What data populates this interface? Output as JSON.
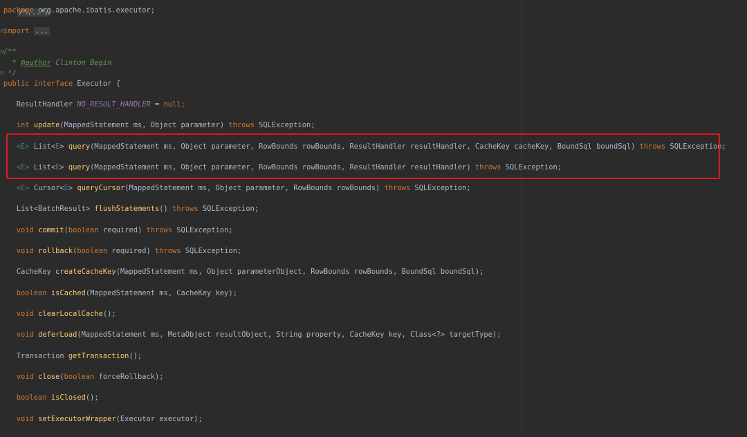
{
  "editor": {
    "lines": {
      "fold_top": "/*...*/",
      "package": {
        "kw": "package",
        "name": "org.apache.ibatis.executor;"
      },
      "import": {
        "kw": "import",
        "fold": "..."
      },
      "javadoc_open": "/**",
      "javadoc_author": {
        "star": "* ",
        "tag": "@author",
        "text": " Clinton Begin"
      },
      "javadoc_close": "*/",
      "interface_decl": {
        "kw1": "public",
        "kw2": "interface",
        "name": "Executor {"
      },
      "no_result_handler": {
        "type": "ResultHandler ",
        "const": "NO_RESULT_HANDLER",
        "rest": " = ",
        "null": "null",
        "end": ";"
      },
      "update": {
        "type": "int ",
        "name": "update",
        "params": "(MappedStatement ms, Object parameter) ",
        "throws": "throws",
        "end": " SQLException;"
      },
      "query1": {
        "g1": "<E>",
        "t": " List<",
        "g2": "E",
        "t2": "> ",
        "name": "query",
        "params": "(MappedStatement ms, Object parameter, RowBounds rowBounds, ResultHandler resultHandler, CacheKey cacheKey, BoundSql boundSql) ",
        "throws": "throws",
        "end": " SQLException;"
      },
      "query2": {
        "g1": "<E>",
        "t": " List<",
        "g2": "E",
        "t2": "> ",
        "name": "query",
        "params": "(MappedStatement ms, Object parameter, RowBounds rowBounds, ResultHandler resultHandler) ",
        "throws": "throws",
        "end": " SQLException;"
      },
      "query_cursor": {
        "g1": "<E>",
        "t": " Cursor<",
        "g2": "E",
        "t2": "> ",
        "name": "queryCursor",
        "params": "(MappedStatement ms, Object parameter, RowBounds rowBounds) ",
        "throws": "throws",
        "end": " SQLException;"
      },
      "flush": {
        "type": "List<BatchResult> ",
        "name": "flushStatements",
        "params": "() ",
        "throws": "throws",
        "end": " SQLException;"
      },
      "commit": {
        "type": "void ",
        "name": "commit",
        "p1": "(",
        "pkw": "boolean",
        "p2": " required) ",
        "throws": "throws",
        "end": " SQLException;"
      },
      "rollback": {
        "type": "void ",
        "name": "rollback",
        "p1": "(",
        "pkw": "boolean",
        "p2": " required) ",
        "throws": "throws",
        "end": " SQLException;"
      },
      "create_cache_key": {
        "type": "CacheKey ",
        "name": "createCacheKey",
        "params": "(MappedStatement ms, Object parameterObject, RowBounds rowBounds, BoundSql boundSql);"
      },
      "is_cached": {
        "type": "boolean ",
        "name": "isCached",
        "params": "(MappedStatement ms, CacheKey key);"
      },
      "clear_local_cache": {
        "type": "void ",
        "name": "clearLocalCache",
        "params": "();"
      },
      "defer_load": {
        "type": "void ",
        "name": "deferLoad",
        "params": "(MappedStatement ms, MetaObject resultObject, String property, CacheKey key, Class<?> targetType);"
      },
      "get_transaction": {
        "type": "Transaction ",
        "name": "getTransaction",
        "params": "();"
      },
      "close": {
        "type": "void ",
        "name": "close",
        "p1": "(",
        "pkw": "boolean",
        "p2": " forceRollback);"
      },
      "is_closed": {
        "type": "boolean ",
        "name": "isClosed",
        "params": "();"
      },
      "set_wrapper": {
        "type": "void ",
        "name": "setExecutorWrapper",
        "params": "(Executor executor);"
      }
    }
  },
  "colors": {
    "background": "#2b2b2b",
    "keyword": "#cc7832",
    "method": "#ffc66d",
    "constant": "#9876aa",
    "comment": "#629755",
    "highlight_box": "#e0191e"
  }
}
